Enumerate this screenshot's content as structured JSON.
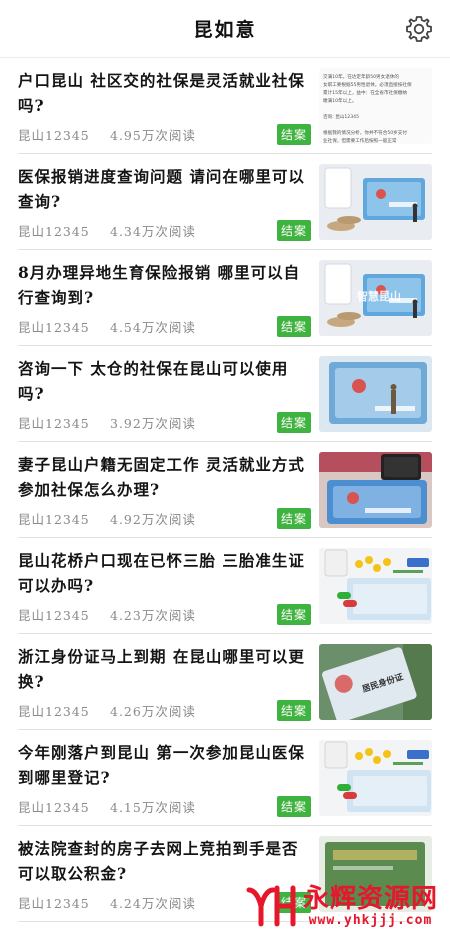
{
  "header": {
    "title": "昆如意",
    "settings_icon": "gear-icon"
  },
  "items": [
    {
      "title": "户口昆山 社区交的社保是灵活就业社保吗?",
      "source": "昆山12345",
      "reads": "4.95万次阅读",
      "badge": "结案",
      "thumb": "document-text",
      "thumb_text": [
        "交满10年。在达定年龄50男女退休的",
        "女职工要根据55男性退休，必须直接按社保",
        "累计15年以上，益中：在全省市社保缴纳",
        "缴满10年以上。",
        "",
        "咨询: 昆山12345",
        "",
        "根据我的情况分析，你并不符合50岁支付",
        "业社保，但需要工作后按照一般正常"
      ]
    },
    {
      "title": "医保报销进度查询问题 请问在哪里可以查询?",
      "source": "昆山12345",
      "reads": "4.34万次阅读",
      "badge": "结案",
      "thumb": "card-pills"
    },
    {
      "title": "8月办理异地生育保险报销 哪里可以自行查询到?",
      "source": "昆山12345",
      "reads": "4.54万次阅读",
      "badge": "结案",
      "thumb": "card-pills-wm",
      "thumb_text": [
        "智慧昆山"
      ]
    },
    {
      "title": "咨询一下 太仓的社保在昆山可以使用吗?",
      "source": "昆山12345",
      "reads": "3.92万次阅读",
      "badge": "结案",
      "thumb": "card-figure"
    },
    {
      "title": "妻子昆山户籍无固定工作 灵活就业方式参加社保怎么办理?",
      "source": "昆山12345",
      "reads": "4.92万次阅读",
      "badge": "结案",
      "thumb": "card-phone"
    },
    {
      "title": "昆山花桥户口现在已怀三胎 三胎准生证可以办吗?",
      "source": "昆山12345",
      "reads": "4.23万次阅读",
      "badge": "结案",
      "thumb": "medicine"
    },
    {
      "title": "浙江身份证马上到期 在昆山哪里可以更换?",
      "source": "昆山12345",
      "reads": "4.26万次阅读",
      "badge": "结案",
      "thumb": "id-card",
      "thumb_text": [
        "居民身份证"
      ]
    },
    {
      "title": "今年刚落户到昆山 第一次参加昆山医保到哪里登记?",
      "source": "昆山12345",
      "reads": "4.15万次阅读",
      "badge": "结案",
      "thumb": "medicine"
    },
    {
      "title": "被法院查封的房子去网上竞拍到手是否可以取公积金?",
      "source": "昆山12345",
      "reads": "4.24万次阅读",
      "badge": "结案",
      "thumb": "green-doc"
    }
  ],
  "watermark": {
    "main": "永辉资源网",
    "url": "www.yhkjjj.com"
  },
  "colors": {
    "badge": "#3fb33f",
    "watermark": "#e6162d"
  }
}
